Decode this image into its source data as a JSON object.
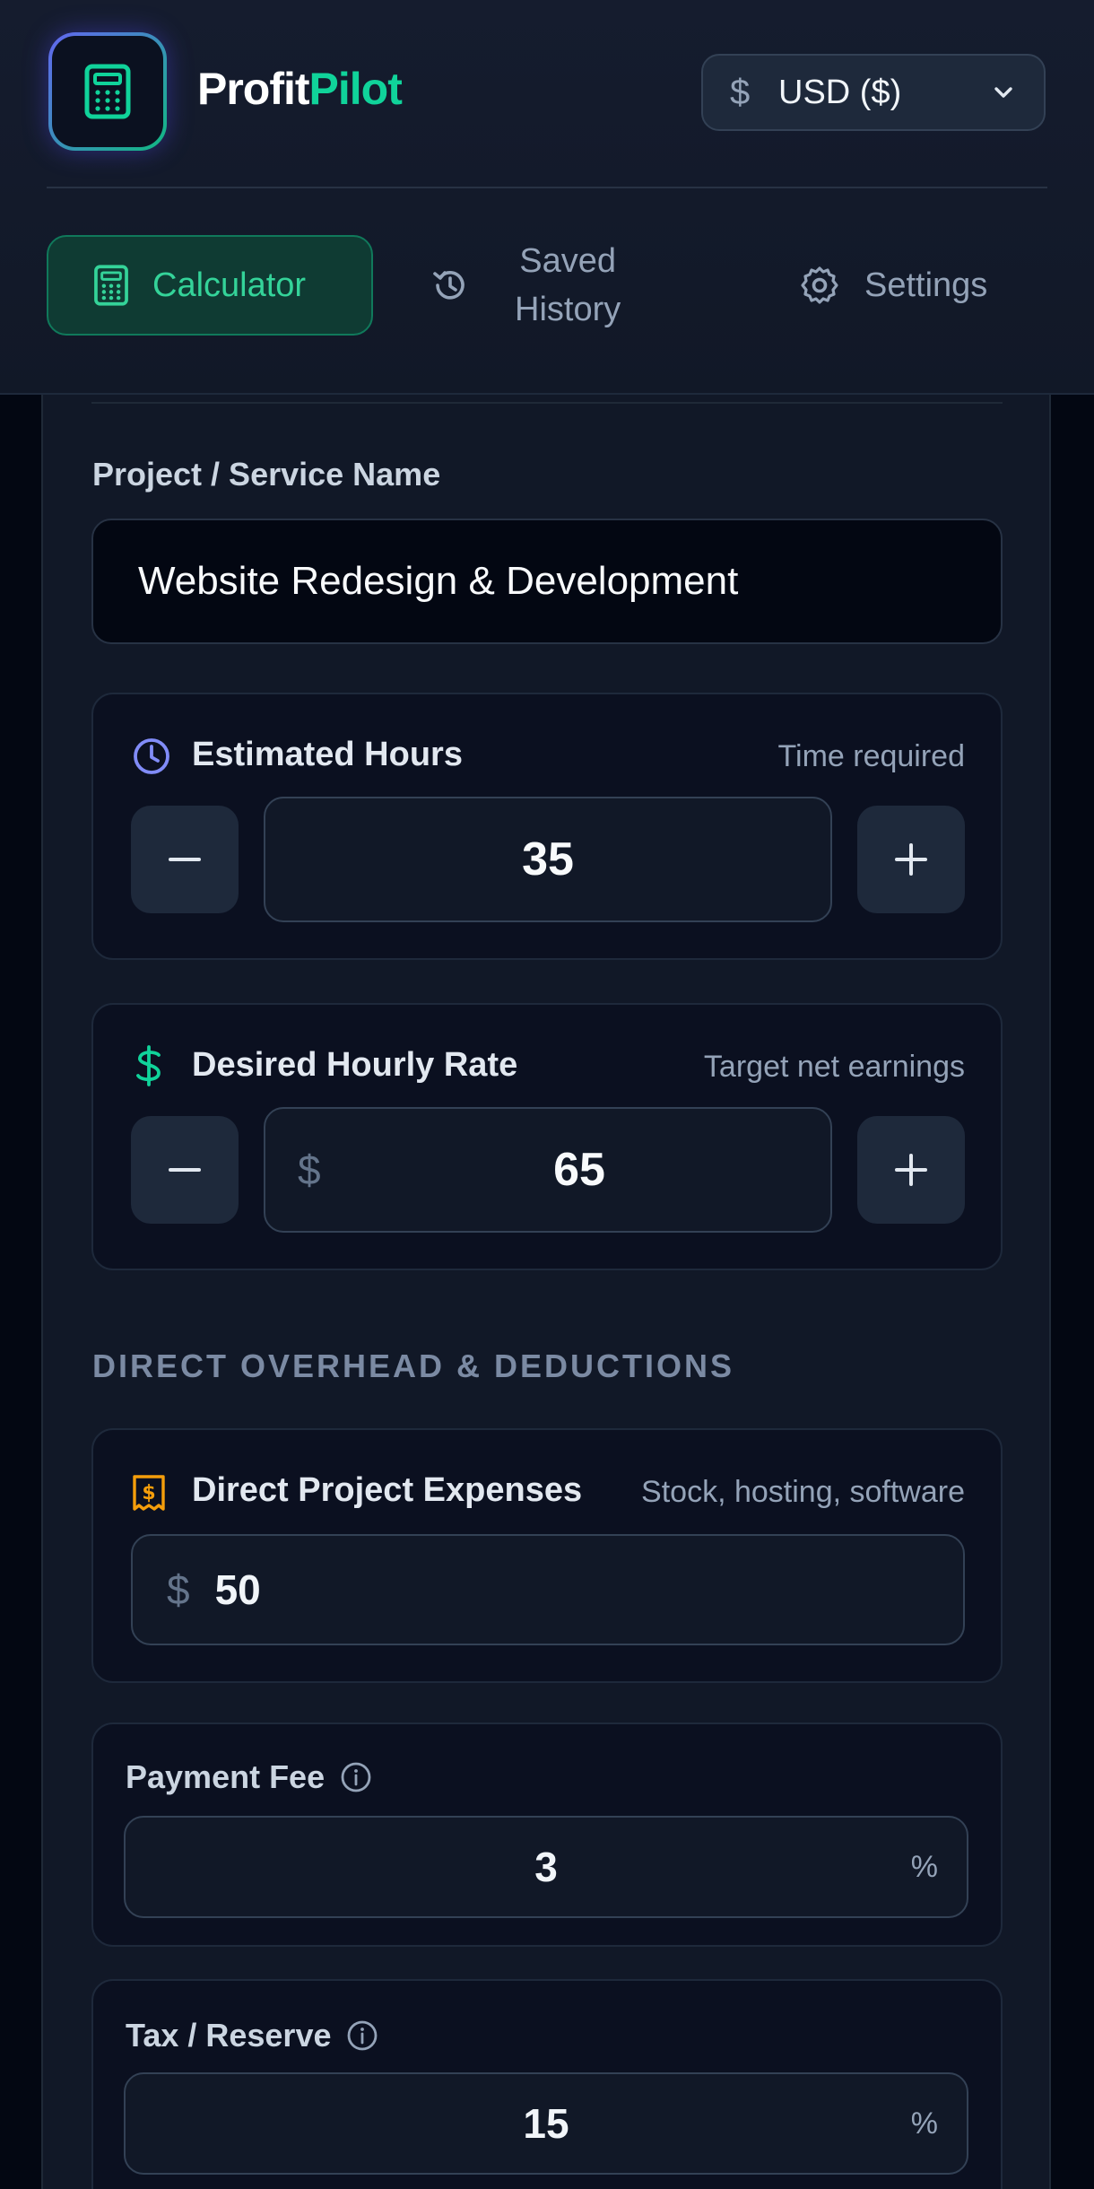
{
  "header": {
    "brand_part1": "Profit",
    "brand_part2": "Pilot",
    "logo_icon": "calculator-icon",
    "currency": {
      "symbol": "$",
      "label": "USD ($)"
    }
  },
  "tabs": [
    {
      "label": "Calculator",
      "icon": "calculator-icon",
      "active": true
    },
    {
      "label_line1": "Saved",
      "label_line2": "History",
      "icon": "history-icon"
    },
    {
      "label": "Settings",
      "icon": "gear-icon"
    }
  ],
  "project": {
    "label": "Project / Service Name",
    "value": "Website Redesign & Development"
  },
  "hours": {
    "title": "Estimated Hours",
    "hint": "Time required",
    "value": "35",
    "icon": "clock-icon"
  },
  "rate": {
    "title": "Desired Hourly Rate",
    "hint": "Target net earnings",
    "symbol": "$",
    "value": "65",
    "icon": "dollar-icon"
  },
  "overhead": {
    "heading": "DIRECT OVERHEAD & DEDUCTIONS",
    "expenses": {
      "title": "Direct Project Expenses",
      "hint": "Stock, hosting, software",
      "symbol": "$",
      "value": "50",
      "icon": "receipt-icon"
    },
    "payment_fee": {
      "label": "Payment Fee",
      "value": "3",
      "unit": "%"
    },
    "tax_reserve": {
      "label": "Tax / Reserve",
      "value": "15",
      "unit": "%"
    }
  },
  "colors": {
    "accent_green": "#10d39a",
    "accent_purple": "#818cf8",
    "accent_amber": "#f59e0b",
    "background": "#030712"
  }
}
